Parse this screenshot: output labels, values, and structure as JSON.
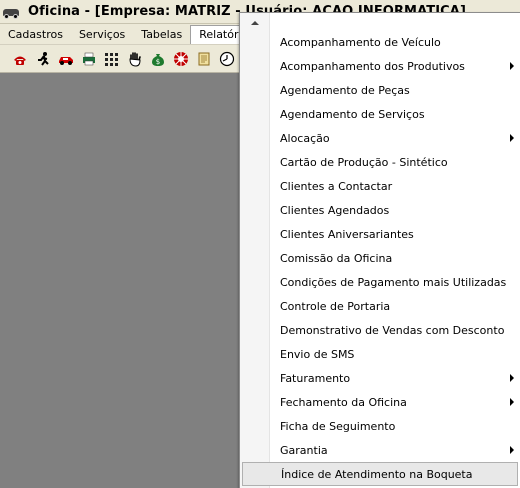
{
  "window": {
    "title": "Oficina - [Empresa: MATRIZ - Usuário: ACAO INFORMATICA]"
  },
  "menubar": {
    "items": [
      {
        "label": "Cadastros",
        "active": false
      },
      {
        "label": "Serviços",
        "active": false
      },
      {
        "label": "Tabelas",
        "active": false
      },
      {
        "label": "Relatórios",
        "active": true
      }
    ]
  },
  "toolbar": {
    "icons": [
      "telephone-icon",
      "running-man-icon",
      "red-car-icon",
      "printer-icon",
      "grid-icon",
      "hand-icon",
      "money-bag-icon",
      "wheel-icon",
      "scroll-icon",
      "clock-icon"
    ]
  },
  "reports_menu": {
    "items": [
      {
        "label": "Acompanhamento de Veículo",
        "has_submenu": false
      },
      {
        "label": "Acompanhamento dos Produtivos",
        "has_submenu": true
      },
      {
        "label": "Agendamento de Peças",
        "has_submenu": false
      },
      {
        "label": "Agendamento de Serviços",
        "has_submenu": false
      },
      {
        "label": "Alocação",
        "has_submenu": true
      },
      {
        "label": "Cartão de Produção - Sintético",
        "has_submenu": false
      },
      {
        "label": "Clientes a Contactar",
        "has_submenu": false
      },
      {
        "label": "Clientes Agendados",
        "has_submenu": false
      },
      {
        "label": "Clientes Aniversariantes",
        "has_submenu": false
      },
      {
        "label": "Comissão da Oficina",
        "has_submenu": false
      },
      {
        "label": "Condições de Pagamento mais Utilizadas",
        "has_submenu": false
      },
      {
        "label": "Controle de Portaria",
        "has_submenu": false
      },
      {
        "label": "Demonstrativo de Vendas com Desconto",
        "has_submenu": false
      },
      {
        "label": "Envio de SMS",
        "has_submenu": false
      },
      {
        "label": "Faturamento",
        "has_submenu": true
      },
      {
        "label": "Fechamento da Oficina",
        "has_submenu": true
      },
      {
        "label": "Ficha de Seguimento",
        "has_submenu": false
      },
      {
        "label": "Garantia",
        "has_submenu": true
      },
      {
        "label": "Índice de Atendimento na Boqueta",
        "has_submenu": false,
        "hovered": true
      }
    ]
  }
}
